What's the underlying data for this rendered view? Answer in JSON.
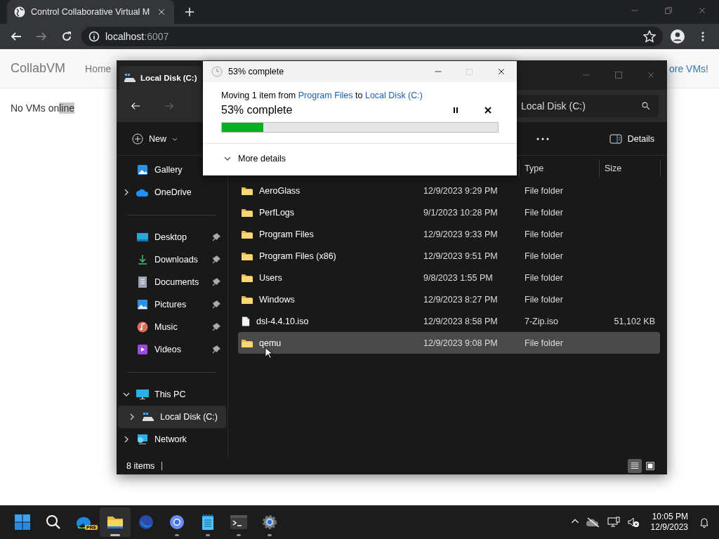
{
  "browser": {
    "tab_title": "Control Collaborative Virtual M",
    "address_host": "localhost",
    "address_port": ":6007"
  },
  "page": {
    "brand": "CollabVM",
    "nav": [
      "Home",
      "ore VMs!"
    ],
    "message": [
      {
        "text": "No VMs on",
        "selected": false
      },
      {
        "text": "line",
        "selected": true
      }
    ]
  },
  "explorer": {
    "tab_title": "Local Disk (C:)",
    "search": {
      "placeholder": "Local Disk (C:)"
    },
    "new_label": "New",
    "details_label": "Details",
    "columns": [
      "Type",
      "Size"
    ],
    "sidebar": [
      [
        {
          "label": "Gallery",
          "selected": false
        },
        {
          "label": "OneDrive",
          "expanded": false,
          "selected": false
        }
      ],
      [
        {
          "label": "Desktop",
          "pinned": true,
          "selected": false
        },
        {
          "label": "Downloads",
          "pinned": true,
          "selected": false
        },
        {
          "label": "Documents",
          "pinned": true,
          "selected": false
        },
        {
          "label": "Pictures",
          "pinned": true,
          "selected": false
        },
        {
          "label": "Music",
          "pinned": true,
          "selected": false
        },
        {
          "label": "Videos",
          "pinned": true,
          "selected": false
        }
      ],
      [
        {
          "label": "This PC",
          "expanded": true,
          "selected": false,
          "children": [
            {
              "label": "Local Disk (C:)",
              "expanded": false,
              "selected": true
            }
          ]
        },
        {
          "label": "Network",
          "expanded": false,
          "selected": false
        }
      ]
    ],
    "files": [
      {
        "name": "AeroGlass",
        "date": "12/9/2023 9:29 PM",
        "type": "File folder",
        "kind": "folder",
        "selected": false
      },
      {
        "name": "PerfLogs",
        "date": "9/1/2023 10:28 PM",
        "type": "File folder",
        "kind": "folder",
        "selected": false
      },
      {
        "name": "Program Files",
        "date": "12/9/2023 9:33 PM",
        "type": "File folder",
        "kind": "folder",
        "selected": false
      },
      {
        "name": "Program Files (x86)",
        "date": "12/9/2023 9:51 PM",
        "type": "File folder",
        "kind": "folder",
        "selected": false
      },
      {
        "name": "Users",
        "date": "9/8/2023 1:55 PM",
        "type": "File folder",
        "kind": "folder",
        "selected": false
      },
      {
        "name": "Windows",
        "date": "12/9/2023 8:27 PM",
        "type": "File folder",
        "kind": "folder",
        "selected": false
      },
      {
        "name": "dsl-4.4.10.iso",
        "date": "12/9/2023 8:58 PM",
        "type": "7-Zip.iso",
        "size": "51,102 KB",
        "kind": "file",
        "selected": false
      },
      {
        "name": "qemu",
        "date": "12/9/2023 9:08 PM",
        "type": "File folder",
        "kind": "folder",
        "selected": true
      }
    ],
    "status": "8 items",
    "views": [
      {
        "selected": true
      },
      {
        "selected": false
      }
    ]
  },
  "dialog": {
    "title": "53% complete",
    "message": [
      {
        "text": "Moving 1 item from",
        "kind": "plain"
      },
      {
        "text": "Program Files",
        "kind": "link"
      },
      {
        "text": "to",
        "kind": "plain"
      },
      {
        "text": "Local Disk (C:)",
        "kind": "link"
      }
    ],
    "heading": "53% complete",
    "level": 0.15,
    "more": "More details"
  },
  "taskbar": {
    "buttons": [
      {
        "active": false,
        "running": false
      },
      {
        "active": false,
        "running": false
      },
      {
        "active": false,
        "running": false,
        "badge": "PRE"
      },
      {
        "active": true,
        "running": true
      },
      {
        "active": false,
        "running": false
      },
      {
        "active": false,
        "running": true
      },
      {
        "active": false,
        "running": true
      },
      {
        "active": false,
        "running": true
      },
      {
        "active": false,
        "running": true
      }
    ],
    "time": "10:05 PM",
    "date": "12/9/2023"
  }
}
